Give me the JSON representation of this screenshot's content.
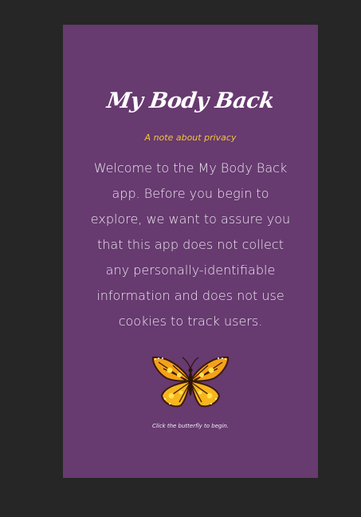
{
  "app": {
    "title": "My Body Back",
    "subtitle": "A note about privacy",
    "message": "Welcome to the My Body Back app. Before you begin to explore, we want to assure you that this app does not collect any personally-identifiable information and does not use cookies to track users.",
    "hint": "Click the butterfly to begin.",
    "butterfly_icon": "butterfly-icon"
  },
  "colors": {
    "background": "#262626",
    "screen": "#673a70",
    "accent": "#f3c53b",
    "text": "#eee8f0"
  }
}
